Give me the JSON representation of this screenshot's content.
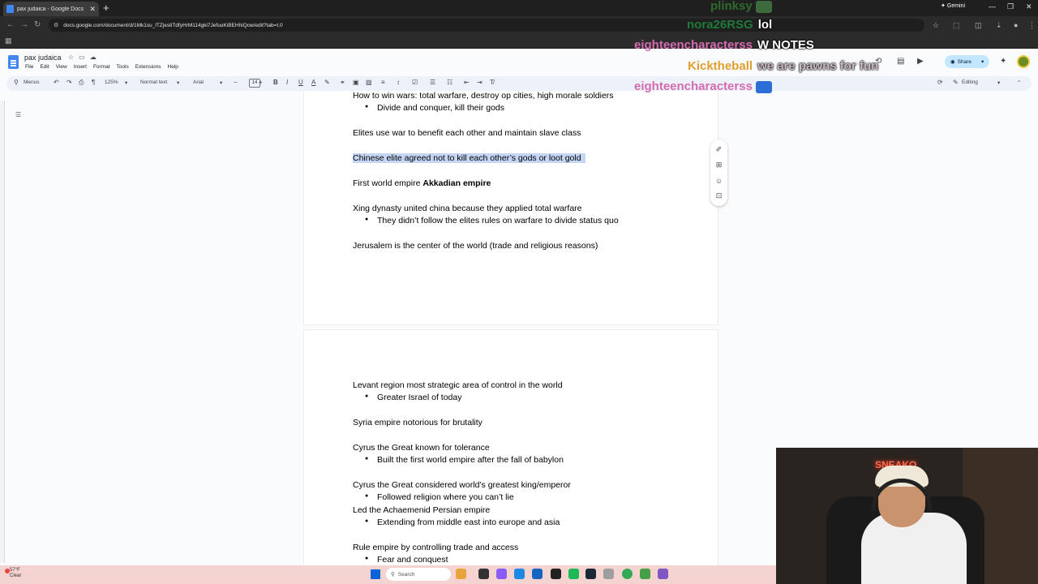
{
  "browser": {
    "tab_title": "pax judaica - Google Docs",
    "tab_close": "✕",
    "new_tab": "+",
    "gemini_label": "Gemini",
    "url": "docs.google.com/document/d/1Mk1su_lTZjestiTdfyHrM114gki7JefuuKiBEHhiQcw/edit?tab=t.0"
  },
  "docs": {
    "title": "pax judaica",
    "menus": [
      "File",
      "Edit",
      "View",
      "Insert",
      "Format",
      "Tools",
      "Extensions",
      "Help"
    ],
    "share_label": "Share",
    "toolbar": {
      "menus_label": "Menus",
      "zoom": "125%",
      "style": "Normal text",
      "font": "Arial",
      "font_size": "14",
      "editing_mode": "Editing"
    },
    "page1_lines": [
      {
        "type": "text",
        "text": "How to win wars: total warfare, destroy op cities, high morale soldiers"
      },
      {
        "type": "bullet",
        "text": "Divide and conquer, kill their gods"
      },
      {
        "type": "text",
        "text": "Elites use war to benefit each other and maintain slave class"
      },
      {
        "type": "text",
        "text": "Chinese elite agreed not to kill each other’s gods or loot gold",
        "highlighted": true
      },
      {
        "type": "text",
        "text": "First world empire ",
        "bold_suffix": "Akkadian empire"
      },
      {
        "type": "text",
        "text": "Xing dynasty united china because they applied total warfare"
      },
      {
        "type": "bullet",
        "text": "They didn’t follow the elites rules on warfare to divide status quo"
      },
      {
        "type": "text",
        "text": "Jerusalem is the center of the world (trade and religious reasons)"
      }
    ],
    "page2_lines": [
      {
        "type": "text",
        "text": "Levant region most strategic area of control in the world"
      },
      {
        "type": "bullet",
        "text": "Greater Israel of today"
      },
      {
        "type": "text",
        "text": "Syria empire notorious for brutality"
      },
      {
        "type": "text",
        "text": "Cyrus the Great known for tolerance"
      },
      {
        "type": "bullet",
        "text": "Built the first world empire after the fall of babylon"
      },
      {
        "type": "text",
        "text": "Cyrus the Great considered world’s greatest king/emperor"
      },
      {
        "type": "bullet",
        "text": "Followed religion where you can’t lie"
      },
      {
        "type": "text",
        "text": "Led the Achaemenid Persian empire"
      },
      {
        "type": "bullet",
        "text": "Extending from middle east into europe and asia"
      },
      {
        "type": "text",
        "text": "Rule empire by controlling trade and access"
      },
      {
        "type": "bullet",
        "text": "Fear and conquest"
      }
    ]
  },
  "chat": [
    {
      "user": "plinksy",
      "msg": "",
      "user_color": "#2e6b2e"
    },
    {
      "user": "nora26RSG",
      "msg": "lol",
      "user_color": "#1f7a3a"
    },
    {
      "user": "eighteencharacterss",
      "msg": "W NOTES",
      "user_color": "#d46bb0"
    },
    {
      "user": "Kicktheball",
      "msg": "we are pawns for fun",
      "user_color": "#e0a030"
    },
    {
      "user": "eighteencharacterss",
      "msg": "",
      "user_color": "#d46bb0"
    }
  ],
  "webcam": {
    "neon_sign": "SNEAKO"
  },
  "taskbar": {
    "weather_temp": "57°F",
    "weather_cond": "Clear",
    "search_label": "Search"
  },
  "colors": {
    "highlight": "#c5d6f5",
    "share_bg": "#c2e7ff",
    "taskbar_bg": "#f4d3d0"
  }
}
